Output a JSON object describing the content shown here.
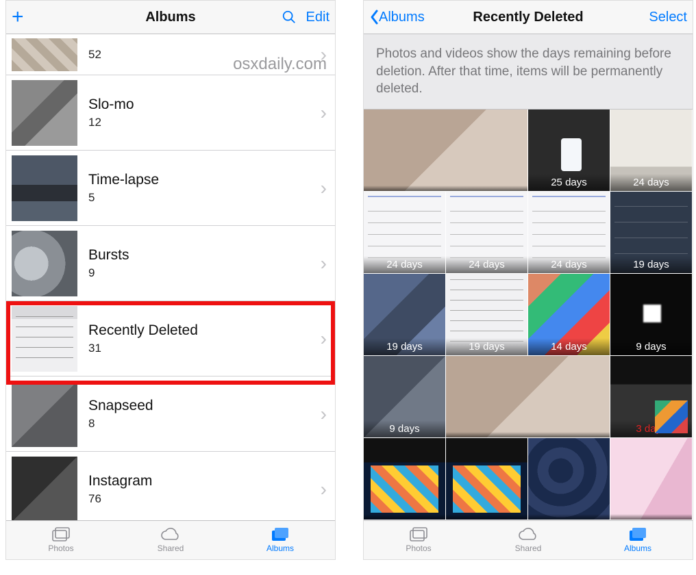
{
  "watermark": "osxdaily.com",
  "colors": {
    "tint": "#007aff",
    "highlight": "#e11"
  },
  "left_screen": {
    "nav": {
      "title": "Albums",
      "edit_label": "Edit"
    },
    "rows": [
      {
        "title": "",
        "count": "52"
      },
      {
        "title": "Slo-mo",
        "count": "12"
      },
      {
        "title": "Time-lapse",
        "count": "5"
      },
      {
        "title": "Bursts",
        "count": "9"
      },
      {
        "title": "Recently Deleted",
        "count": "31",
        "highlighted": true
      },
      {
        "title": "Snapseed",
        "count": "8"
      },
      {
        "title": "Instagram",
        "count": "76"
      }
    ]
  },
  "right_screen": {
    "nav": {
      "back_label": "Albums",
      "title": "Recently Deleted",
      "select_label": "Select"
    },
    "info_text": "Photos and videos show the days remaining before deletion. After that time, items will be permanently deleted.",
    "cells": [
      {
        "span": 2,
        "label": ""
      },
      {
        "span": 1,
        "label": "25 days"
      },
      {
        "span": 1,
        "label": "24 days"
      },
      {
        "span": 1,
        "label": "24 days"
      },
      {
        "span": 1,
        "label": "24 days"
      },
      {
        "span": 1,
        "label": "24 days"
      },
      {
        "span": 1,
        "label": "19 days"
      },
      {
        "span": 1,
        "label": "19 days"
      },
      {
        "span": 1,
        "label": "19 days"
      },
      {
        "span": 1,
        "label": "14 days"
      },
      {
        "span": 1,
        "label": "9 days"
      },
      {
        "span": 1,
        "label": "9 days"
      },
      {
        "span": 2,
        "label": ""
      },
      {
        "span": 1,
        "label": "3 days",
        "red": true
      },
      {
        "span": 1,
        "label": ""
      },
      {
        "span": 1,
        "label": ""
      },
      {
        "span": 1,
        "label": ""
      },
      {
        "span": 1,
        "label": ""
      }
    ]
  },
  "tabs": {
    "photos": "Photos",
    "shared": "Shared",
    "albums": "Albums"
  }
}
